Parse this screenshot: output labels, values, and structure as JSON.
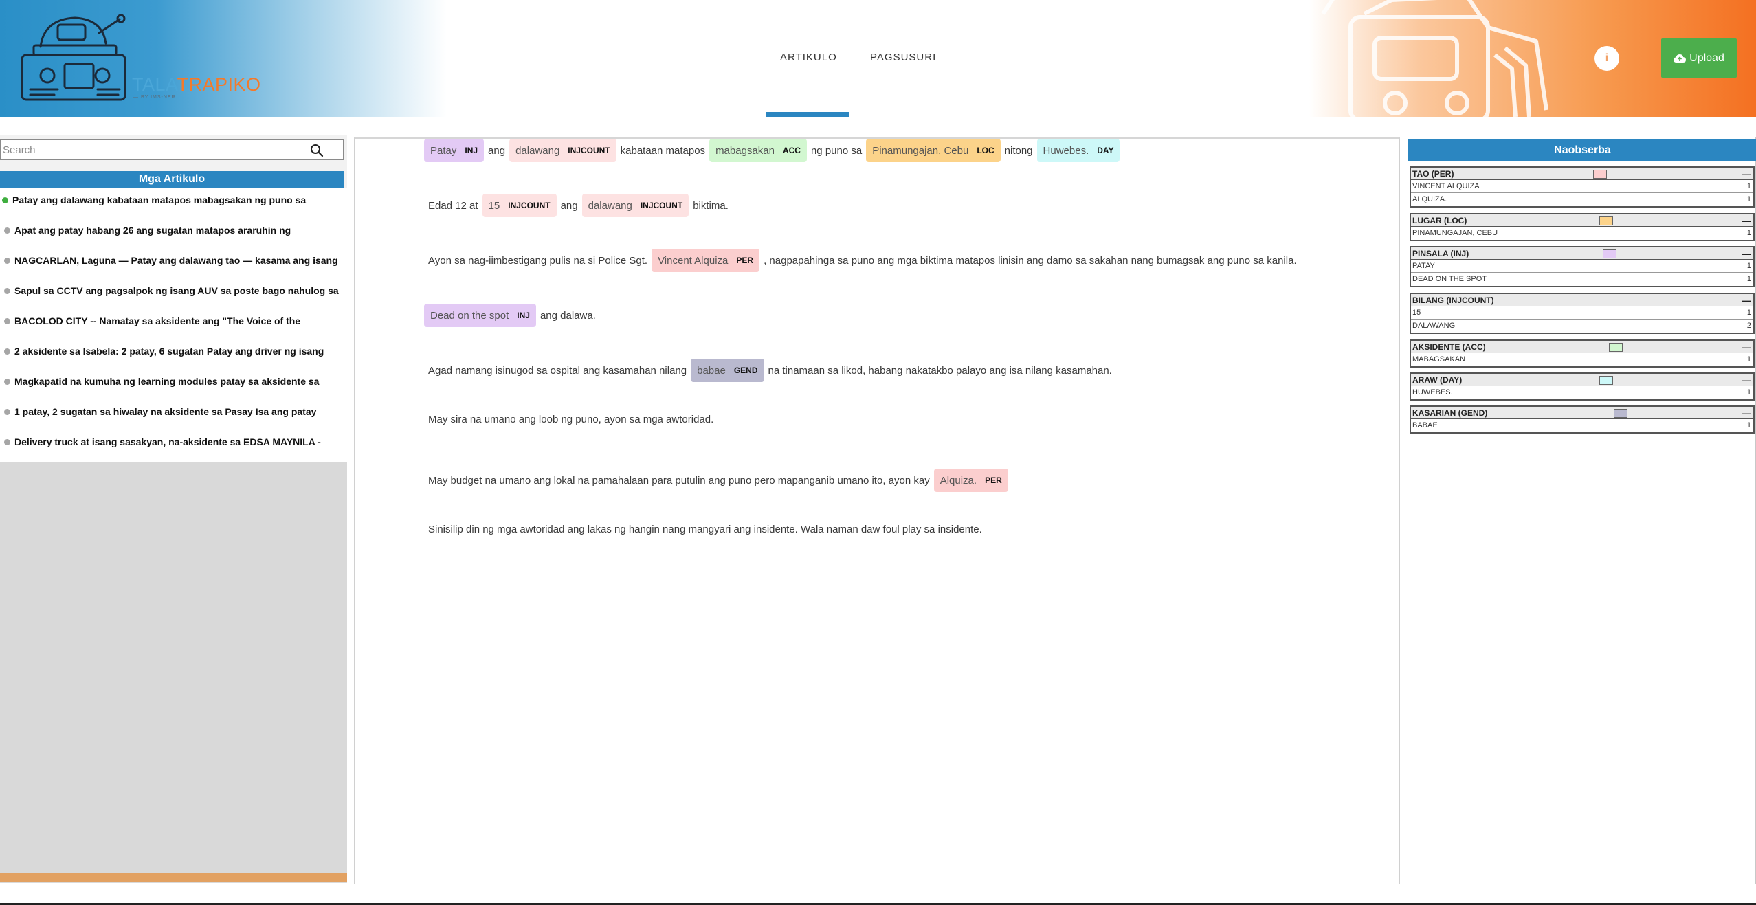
{
  "header": {
    "logo_tala": "TALA",
    "logo_trapiko": "TRAPIKO",
    "logo_sub": "— BY IMS-NER",
    "nav": [
      {
        "label": "ARTIKULO",
        "active": true
      },
      {
        "label": "PAGSUSURI",
        "active": false
      }
    ],
    "info_label": "i",
    "upload_label": "Upload"
  },
  "sidebar": {
    "search_placeholder": "Search",
    "articles_title": "Mga Artikulo",
    "articles": [
      {
        "title": "Patay ang dalawang kabataan matapos mabagsakan ng puno sa",
        "active": true
      },
      {
        "title": "Apat ang patay habang 26 ang sugatan matapos araruhin ng",
        "active": false
      },
      {
        "title": "NAGCARLAN, Laguna — Patay ang dalawang tao — kasama ang isang",
        "active": false
      },
      {
        "title": "Sapul sa CCTV ang pagsalpok ng isang AUV sa poste bago nahulog sa",
        "active": false
      },
      {
        "title": "BACOLOD CITY -- Namatay sa aksidente ang \"The Voice of the",
        "active": false
      },
      {
        "title": "2 aksidente sa Isabela: 2 patay, 6 sugatan Patay ang driver ng isang",
        "active": false
      },
      {
        "title": "Magkapatid na kumuha ng learning modules patay sa aksidente sa",
        "active": false
      },
      {
        "title": "1 patay, 2 sugatan sa hiwalay na aksidente sa Pasay Isa ang patay",
        "active": false
      },
      {
        "title": "Delivery truck at isang sasakyan, na-aksidente sa EDSA MAYNILA -",
        "active": false
      }
    ]
  },
  "article": {
    "p1": {
      "e1": "Patay",
      "e1_tag": "INJ",
      "t1": "ang",
      "e2": "dalawang",
      "e2_tag": "INJCOUNT",
      "t2": "kabataan matapos",
      "e3": "mabagsakan",
      "e3_tag": "ACC",
      "t3": "ng puno sa",
      "e4": "Pinamungajan, Cebu",
      "e4_tag": "LOC",
      "t4": "nitong",
      "e5": "Huwebes.",
      "e5_tag": "DAY"
    },
    "p2": {
      "t1": "Edad 12 at",
      "e1": "15",
      "e1_tag": "INJCOUNT",
      "t2": "ang",
      "e2": "dalawang",
      "e2_tag": "INJCOUNT",
      "t3": "biktima."
    },
    "p3": {
      "t1": "Ayon sa nag-iimbestigang pulis na si Police Sgt.",
      "e1": "Vincent Alquiza",
      "e1_tag": "PER",
      "t2": ", nagpapahinga sa puno ang mga biktima matapos linisin ang damo sa sakahan nang bumagsak ang puno sa kanila."
    },
    "p4": {
      "e1": "Dead on the spot",
      "e1_tag": "INJ",
      "t1": "ang dalawa."
    },
    "p5": {
      "t1": "Agad namang isinugod sa ospital ang kasamahan nilang",
      "e1": "babae",
      "e1_tag": "GEND",
      "t2": "na tinamaan sa likod, habang nakatakbo palayo ang isa nilang kasamahan."
    },
    "p6": {
      "t1": "May sira na umano ang loob ng puno, ayon sa mga awtoridad."
    },
    "p7": {
      "t1": "May budget na umano ang lokal na pamahalaan para putulin ang puno pero mapanganib umano ito, ayon kay",
      "e1": "Alquiza.",
      "e1_tag": "PER"
    },
    "p8": {
      "t1": "Sinisilip din ng mga awtoridad ang lakas ng hangin nang mangyari ang insidente. Wala naman daw foul play sa insidente."
    }
  },
  "observed": {
    "title": "Naobserba",
    "collapse_symbol": "—",
    "groups": [
      {
        "label": "TAO (PER)",
        "color": "#fbcece",
        "rows": [
          {
            "name": "VINCENT ALQUIZA",
            "count": "1"
          },
          {
            "name": "ALQUIZA.",
            "count": "1"
          }
        ]
      },
      {
        "label": "LUGAR (LOC)",
        "color": "#fcd38a",
        "rows": [
          {
            "name": "PINAMUNGAJAN, CEBU",
            "count": "1"
          }
        ]
      },
      {
        "label": "PINSALA (INJ)",
        "color": "#e3caf5",
        "rows": [
          {
            "name": "PATAY",
            "count": "1"
          },
          {
            "name": "DEAD ON THE SPOT",
            "count": "1"
          }
        ]
      },
      {
        "label": "BILANG (INJCOUNT)",
        "color": "#fde2e2",
        "rows": [
          {
            "name": "15",
            "count": "1"
          },
          {
            "name": "DALAWANG",
            "count": "2"
          }
        ]
      },
      {
        "label": "AKSIDENTE (ACC)",
        "color": "#d2f7d0",
        "rows": [
          {
            "name": "MABAGSAKAN",
            "count": "1"
          }
        ]
      },
      {
        "label": "ARAW (DAY)",
        "color": "#cdf8f8",
        "rows": [
          {
            "name": "HUWEBES.",
            "count": "1"
          }
        ]
      },
      {
        "label": "KASARIAN (GEND)",
        "color": "#b9b9cf",
        "rows": [
          {
            "name": "BABAE",
            "count": "1"
          }
        ]
      }
    ]
  }
}
